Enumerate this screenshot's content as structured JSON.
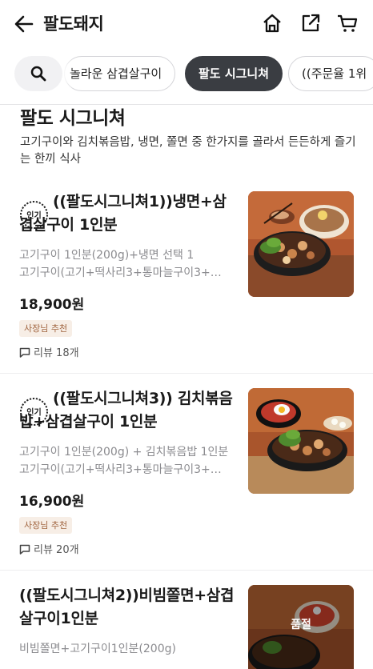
{
  "header": {
    "store_name": "팔도돼지"
  },
  "categories": {
    "chips": [
      "놀라운 삼겹살구이",
      "팔도 시그니쳐",
      "((주문율 1위 "
    ],
    "active": "팔도 시그니쳐"
  },
  "section": {
    "title": "팔도 시그니쳐",
    "description": "고기구이와 김치볶음밥, 냉면, 쫄면 중 한가지를 골라서 든든하게 즐기는 한끼 식사"
  },
  "items": [
    {
      "badge": "인기",
      "name": "((팔도시그니쳐1))냉면+삼겹살구이 1인분",
      "desc_line1": "고기구이 1인분(200g)+냉면 선택 1",
      "desc_line2": "고기구이(고기+떡사리3+통마늘구이3+…",
      "price": "18,900원",
      "owner_pick": "사장님 추천",
      "reviews": "리뷰 18개"
    },
    {
      "badge": "인기",
      "name": "((팔도시그니쳐3)) 김치볶음밥+삼겹살구이 1인분",
      "desc_line1": "고기구이 1인분(200g) + 김치볶음밥 1인분",
      "desc_line2": "고기구이(고기+떡사리3+통마늘구이3+…",
      "price": "16,900원",
      "owner_pick": "사장님 추천",
      "reviews": "리뷰 20개"
    },
    {
      "name": "((팔도시그니쳐2))비빔쫄면+삼겹살구이1인분",
      "desc_line1": "비빔쫄면+고기구이1인분(200g)",
      "status": "품절"
    }
  ],
  "colors": {
    "active_chip": "#3a3d42",
    "owner_badge_bg": "#f7eee6",
    "owner_badge_text": "#a0643f",
    "desc_text": "#8b8b8f"
  }
}
